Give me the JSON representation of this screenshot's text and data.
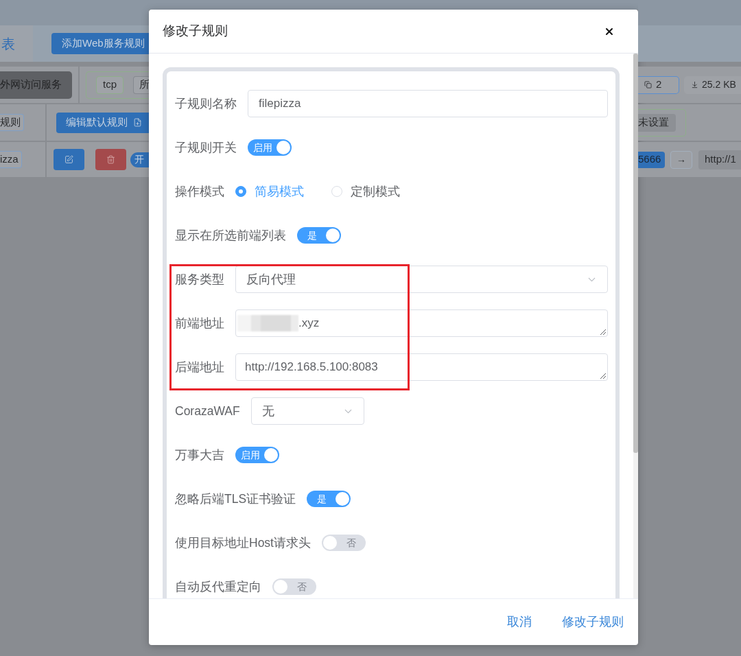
{
  "background": {
    "tab": {
      "label": "表",
      "selected": true
    },
    "add_button": "添加Web服务规则",
    "service": {
      "name": "外网访问服务",
      "protocol": "tcp",
      "scope": "所",
      "connections": "2",
      "traffic": "25.2 KB"
    },
    "default_rule": {
      "tag": "规则",
      "edit_button": "编辑默认规则",
      "status": "未设置"
    },
    "sub_rule": {
      "name": "izza",
      "switch": {
        "label": "开",
        "on": true
      },
      "port": "5666",
      "arrow": "→",
      "target": "http://1"
    }
  },
  "dialog": {
    "title": "修改子规则",
    "fields": [
      {
        "kind": "input",
        "label": "子规则名称",
        "value": "filepizza",
        "highlighted": false
      },
      {
        "kind": "toggle",
        "label": "子规则开关",
        "text": "启用",
        "on": true,
        "highlighted": false
      },
      {
        "kind": "radio",
        "label": "操作模式",
        "options": [
          {
            "label": "简易模式",
            "selected": true
          },
          {
            "label": "定制模式",
            "selected": false
          }
        ],
        "highlighted": false
      },
      {
        "kind": "toggle",
        "label": "显示在所选前端列表",
        "text": "是",
        "on": true,
        "highlighted": false
      },
      {
        "kind": "select",
        "label": "服务类型",
        "value": "反向代理",
        "highlighted": true
      },
      {
        "kind": "textarea",
        "label": "前端地址",
        "value": ".xyz",
        "redacted": true,
        "highlighted": true
      },
      {
        "kind": "textarea",
        "label": "后端地址",
        "value": "http://192.168.5.100:8083",
        "redacted": false,
        "highlighted": true
      },
      {
        "kind": "dropdown",
        "label": "CorazaWAF",
        "value": "无",
        "highlighted": false
      },
      {
        "kind": "toggle",
        "label": "万事大吉",
        "text": "启用",
        "on": true,
        "highlighted": false
      },
      {
        "kind": "toggle",
        "label": "忽略后端TLS证书验证",
        "text": "是",
        "on": true,
        "highlighted": false
      },
      {
        "kind": "toggle",
        "label": "使用目标地址Host请求头",
        "text": "否",
        "on": false,
        "highlighted": false
      },
      {
        "kind": "toggle",
        "label": "自动反代重定向",
        "text": "否",
        "on": false,
        "highlighted": false
      }
    ],
    "buttons": [
      "取消",
      "修改子规则"
    ]
  }
}
